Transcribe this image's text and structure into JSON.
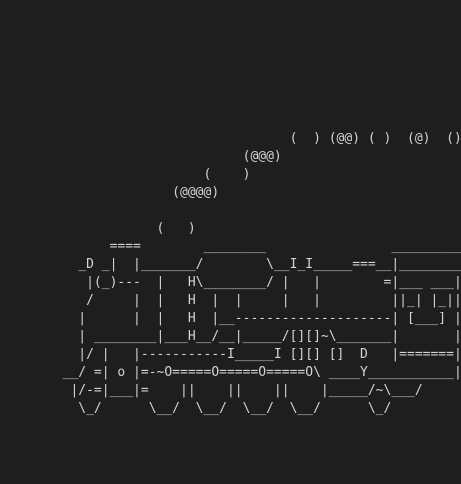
{
  "terminal": {
    "lines": [
      "                                     (  ) (@@) ( )  (@)  ()",
      "                               (@@@)",
      "                          (    )",
      "                      (@@@@)",
      "",
      "                    (   )",
      "              ====        ________                ___________",
      "          _D _|  |_______/        \\__I_I_____===__|_________|",
      "           |(_)---  |   H\\________/ |   |        =|___ ___|",
      "           /     |  |   H  |  |     |   |         ||_| |_||",
      "          |      |  |   H  |__--------------------| [___] |",
      "          | ________|___H__/__|_____/[][]~\\_______|       |",
      "          |/ |   |-----------I_____I [][] []  D   |=======|__",
      "        __/ =| o |=-~O=====O=====O=====O\\ ____Y___________|__",
      "         |/-=|___|=    ||    ||    ||    |_____/~\\___/",
      "          \\_/      \\__/  \\__/  \\__/  \\__/      \\_/"
    ]
  }
}
